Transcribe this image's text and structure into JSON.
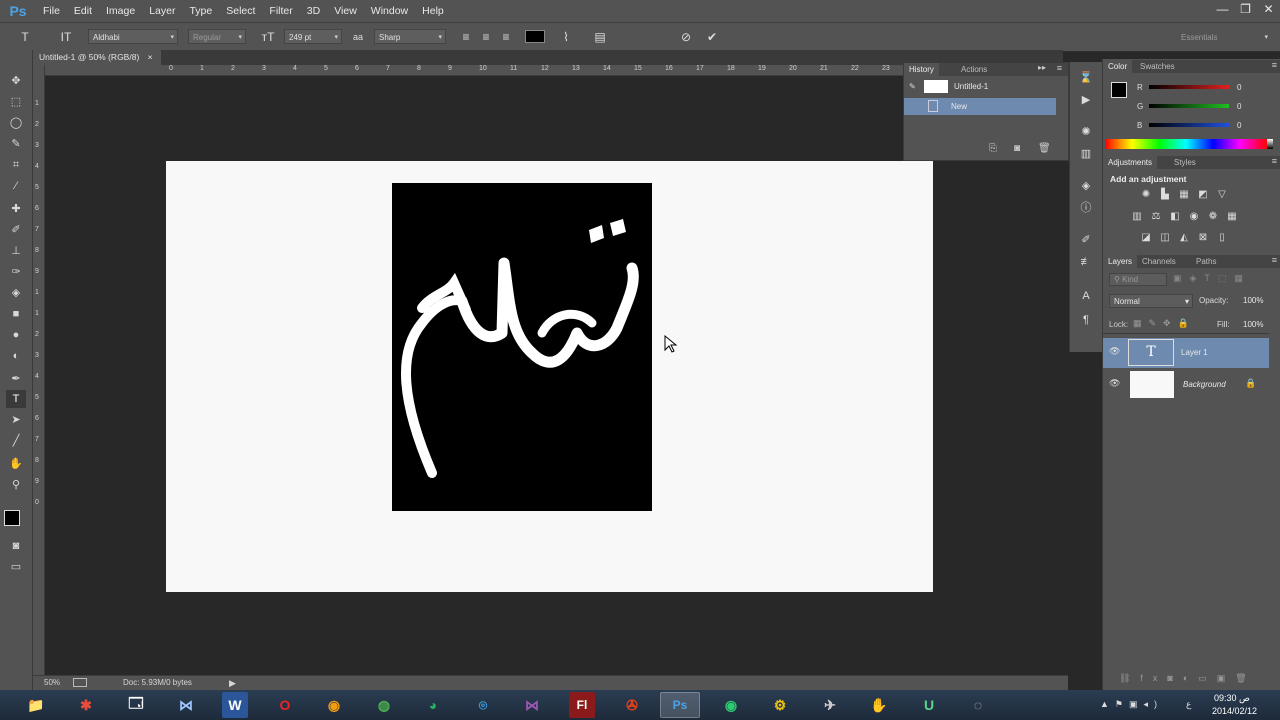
{
  "app": {
    "logo": "Ps"
  },
  "menu": [
    "File",
    "Edit",
    "Image",
    "Layer",
    "Type",
    "Select",
    "Filter",
    "3D",
    "View",
    "Window",
    "Help"
  ],
  "window_controls": {
    "minimize": "—",
    "restore": "❐",
    "close": "✕"
  },
  "options": {
    "font_family": "Aldhabi",
    "font_style": "Regular",
    "font_size": "249 pt",
    "antialias_icon": "aa",
    "antialias": "Sharp",
    "workspace": "Essentials",
    "text_color": "#000000"
  },
  "document": {
    "tab_title": "Untitled-1 @ 50% (RGB/8)",
    "tab_close": "×",
    "text_content": "تمام",
    "canvas_color": "#f8f8f8",
    "textbox_color": "#000000",
    "ruler_top": [
      "0",
      "1",
      "2",
      "3",
      "4",
      "5",
      "6",
      "7",
      "8",
      "9",
      "10",
      "11",
      "12",
      "13",
      "14",
      "15",
      "16",
      "17",
      "18",
      "19",
      "20",
      "21",
      "22",
      "23"
    ],
    "ruler_left": [
      "1",
      "2",
      "3",
      "4",
      "5",
      "6",
      "7",
      "8",
      "9",
      "1",
      "1",
      "2",
      "3",
      "4",
      "5",
      "6",
      "7",
      "8",
      "9",
      "0"
    ],
    "zoom": "50%",
    "doc_info": "Doc: 5.93M/0 bytes"
  },
  "history": {
    "tabs": [
      "History",
      "Actions"
    ],
    "snapshot": "Untitled-1",
    "steps": [
      "New"
    ]
  },
  "color": {
    "tabs": [
      "Color",
      "Swatches"
    ],
    "channels": [
      {
        "label": "R",
        "value": "0",
        "color": "#e02020"
      },
      {
        "label": "G",
        "value": "0",
        "color": "#20c020"
      },
      {
        "label": "B",
        "value": "0",
        "color": "#2050e0"
      }
    ]
  },
  "adjustments": {
    "tabs": [
      "Adjustments",
      "Styles"
    ],
    "heading": "Add an adjustment"
  },
  "layers": {
    "tabs": [
      "Layers",
      "Channels",
      "Paths"
    ],
    "kind": "Kind",
    "blend_mode": "Normal",
    "opacity_label": "Opacity:",
    "opacity": "100%",
    "lock_label": "Lock:",
    "fill_label": "Fill:",
    "fill": "100%",
    "items": [
      {
        "name": "Layer 1",
        "thumb": "T"
      },
      {
        "name": "Background",
        "thumb": ""
      }
    ]
  },
  "taskbar": {
    "apps": [
      "📁",
      "✱",
      "🗔",
      "⋈",
      "W",
      "O",
      "◉",
      "◍",
      "◕",
      "⌾",
      "⋈",
      "Fl",
      "✇",
      "Ps",
      "◉",
      "⚙",
      "✈",
      "✋",
      "U",
      "◌"
    ],
    "clock_time": "09:30",
    "clock_ampm": "ص",
    "clock_date": "2014/02/12",
    "lang": "ع"
  }
}
